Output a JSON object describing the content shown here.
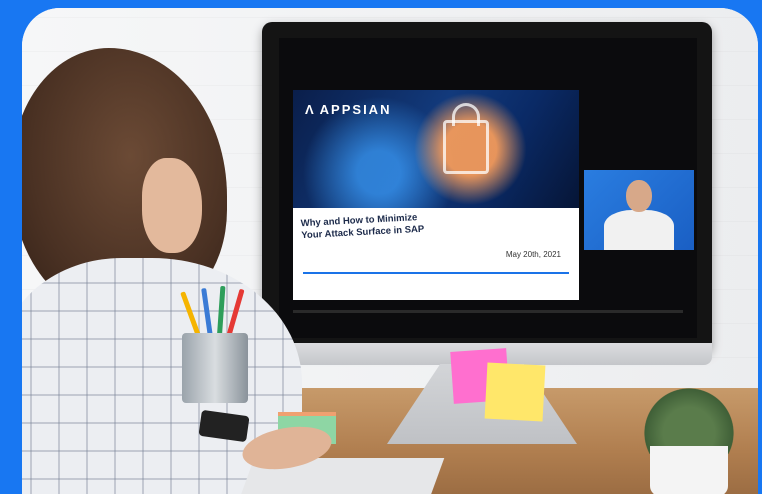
{
  "slide": {
    "brand": "APPSIAN",
    "title_line1": "Why and How to Minimize",
    "title_line2": "Your Attack Surface in SAP",
    "date": "May 20th, 2021"
  },
  "colors": {
    "background": "#1877f2",
    "accent": "#1a73e8"
  }
}
